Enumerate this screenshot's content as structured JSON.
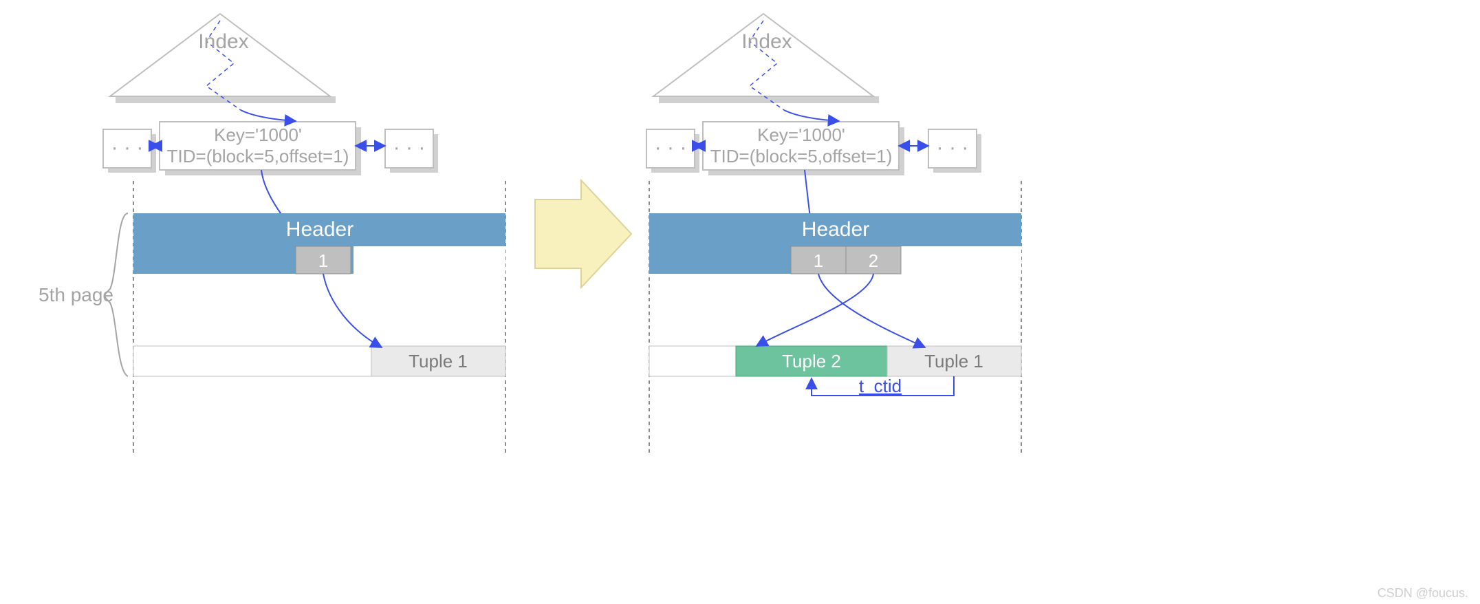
{
  "labels": {
    "index": "Index",
    "key": "Key='1000'",
    "tid": "TID=(block=5,offset=1)",
    "header": "Header",
    "page_label": "5th page",
    "slot1": "1",
    "slot2": "2",
    "tuple1": "Tuple 1",
    "tuple2": "Tuple  2",
    "tctid": "t_ctid",
    "dots": "·  ·  ·",
    "watermark": "CSDN @foucus."
  },
  "colors": {
    "blue_header": "#6a9fc7",
    "slot_gray": "#bfbfbf",
    "slot_gray_border": "#8e8e8e",
    "tuple_gray": "#eaeaea",
    "tuple_green": "#6cc39d",
    "arrow_blue": "#3a4eea",
    "arrow_yellow": "#f8f0bd",
    "text_gray": "#a4a4a4",
    "text_white": "#ffffff",
    "text_dark": "#7a7a7a",
    "shadow": "#d0d0d0",
    "box_stroke": "#bfbfbf"
  }
}
